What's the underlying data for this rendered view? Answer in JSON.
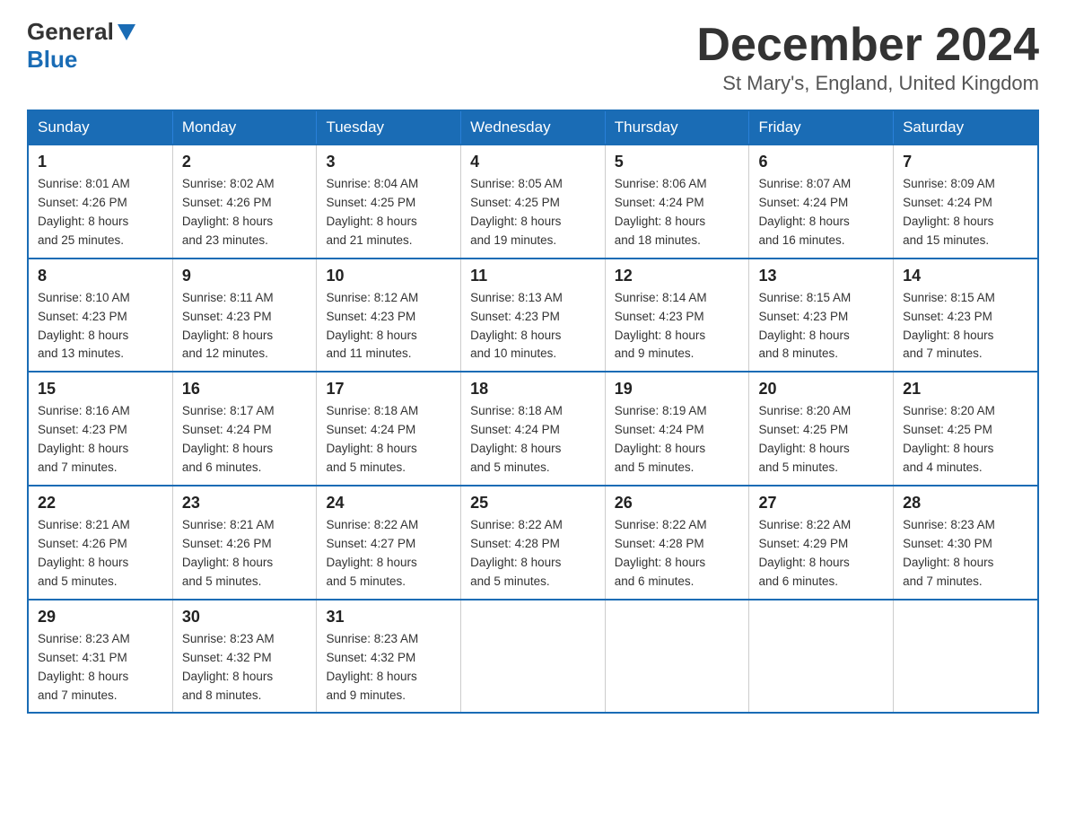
{
  "header": {
    "logo_general": "General",
    "logo_blue": "Blue",
    "month_title": "December 2024",
    "location": "St Mary's, England, United Kingdom"
  },
  "weekdays": [
    "Sunday",
    "Monday",
    "Tuesday",
    "Wednesday",
    "Thursday",
    "Friday",
    "Saturday"
  ],
  "weeks": [
    [
      {
        "day": "1",
        "info": "Sunrise: 8:01 AM\nSunset: 4:26 PM\nDaylight: 8 hours\nand 25 minutes."
      },
      {
        "day": "2",
        "info": "Sunrise: 8:02 AM\nSunset: 4:26 PM\nDaylight: 8 hours\nand 23 minutes."
      },
      {
        "day": "3",
        "info": "Sunrise: 8:04 AM\nSunset: 4:25 PM\nDaylight: 8 hours\nand 21 minutes."
      },
      {
        "day": "4",
        "info": "Sunrise: 8:05 AM\nSunset: 4:25 PM\nDaylight: 8 hours\nand 19 minutes."
      },
      {
        "day": "5",
        "info": "Sunrise: 8:06 AM\nSunset: 4:24 PM\nDaylight: 8 hours\nand 18 minutes."
      },
      {
        "day": "6",
        "info": "Sunrise: 8:07 AM\nSunset: 4:24 PM\nDaylight: 8 hours\nand 16 minutes."
      },
      {
        "day": "7",
        "info": "Sunrise: 8:09 AM\nSunset: 4:24 PM\nDaylight: 8 hours\nand 15 minutes."
      }
    ],
    [
      {
        "day": "8",
        "info": "Sunrise: 8:10 AM\nSunset: 4:23 PM\nDaylight: 8 hours\nand 13 minutes."
      },
      {
        "day": "9",
        "info": "Sunrise: 8:11 AM\nSunset: 4:23 PM\nDaylight: 8 hours\nand 12 minutes."
      },
      {
        "day": "10",
        "info": "Sunrise: 8:12 AM\nSunset: 4:23 PM\nDaylight: 8 hours\nand 11 minutes."
      },
      {
        "day": "11",
        "info": "Sunrise: 8:13 AM\nSunset: 4:23 PM\nDaylight: 8 hours\nand 10 minutes."
      },
      {
        "day": "12",
        "info": "Sunrise: 8:14 AM\nSunset: 4:23 PM\nDaylight: 8 hours\nand 9 minutes."
      },
      {
        "day": "13",
        "info": "Sunrise: 8:15 AM\nSunset: 4:23 PM\nDaylight: 8 hours\nand 8 minutes."
      },
      {
        "day": "14",
        "info": "Sunrise: 8:15 AM\nSunset: 4:23 PM\nDaylight: 8 hours\nand 7 minutes."
      }
    ],
    [
      {
        "day": "15",
        "info": "Sunrise: 8:16 AM\nSunset: 4:23 PM\nDaylight: 8 hours\nand 7 minutes."
      },
      {
        "day": "16",
        "info": "Sunrise: 8:17 AM\nSunset: 4:24 PM\nDaylight: 8 hours\nand 6 minutes."
      },
      {
        "day": "17",
        "info": "Sunrise: 8:18 AM\nSunset: 4:24 PM\nDaylight: 8 hours\nand 5 minutes."
      },
      {
        "day": "18",
        "info": "Sunrise: 8:18 AM\nSunset: 4:24 PM\nDaylight: 8 hours\nand 5 minutes."
      },
      {
        "day": "19",
        "info": "Sunrise: 8:19 AM\nSunset: 4:24 PM\nDaylight: 8 hours\nand 5 minutes."
      },
      {
        "day": "20",
        "info": "Sunrise: 8:20 AM\nSunset: 4:25 PM\nDaylight: 8 hours\nand 5 minutes."
      },
      {
        "day": "21",
        "info": "Sunrise: 8:20 AM\nSunset: 4:25 PM\nDaylight: 8 hours\nand 4 minutes."
      }
    ],
    [
      {
        "day": "22",
        "info": "Sunrise: 8:21 AM\nSunset: 4:26 PM\nDaylight: 8 hours\nand 5 minutes."
      },
      {
        "day": "23",
        "info": "Sunrise: 8:21 AM\nSunset: 4:26 PM\nDaylight: 8 hours\nand 5 minutes."
      },
      {
        "day": "24",
        "info": "Sunrise: 8:22 AM\nSunset: 4:27 PM\nDaylight: 8 hours\nand 5 minutes."
      },
      {
        "day": "25",
        "info": "Sunrise: 8:22 AM\nSunset: 4:28 PM\nDaylight: 8 hours\nand 5 minutes."
      },
      {
        "day": "26",
        "info": "Sunrise: 8:22 AM\nSunset: 4:28 PM\nDaylight: 8 hours\nand 6 minutes."
      },
      {
        "day": "27",
        "info": "Sunrise: 8:22 AM\nSunset: 4:29 PM\nDaylight: 8 hours\nand 6 minutes."
      },
      {
        "day": "28",
        "info": "Sunrise: 8:23 AM\nSunset: 4:30 PM\nDaylight: 8 hours\nand 7 minutes."
      }
    ],
    [
      {
        "day": "29",
        "info": "Sunrise: 8:23 AM\nSunset: 4:31 PM\nDaylight: 8 hours\nand 7 minutes."
      },
      {
        "day": "30",
        "info": "Sunrise: 8:23 AM\nSunset: 4:32 PM\nDaylight: 8 hours\nand 8 minutes."
      },
      {
        "day": "31",
        "info": "Sunrise: 8:23 AM\nSunset: 4:32 PM\nDaylight: 8 hours\nand 9 minutes."
      },
      null,
      null,
      null,
      null
    ]
  ]
}
